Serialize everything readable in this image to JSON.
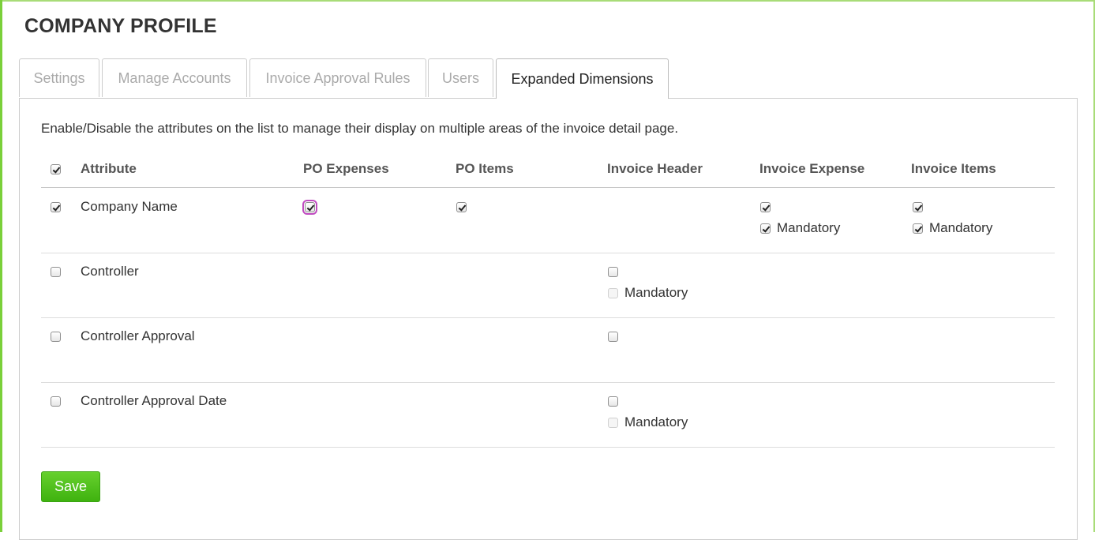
{
  "page": {
    "title": "COMPANY PROFILE"
  },
  "tabs": [
    {
      "label": "Settings"
    },
    {
      "label": "Manage Accounts"
    },
    {
      "label": "Invoice Approval Rules"
    },
    {
      "label": "Users"
    },
    {
      "label": "Expanded Dimensions",
      "active": true
    }
  ],
  "panel": {
    "intro": "Enable/Disable the attributes on the list to manage their display on multiple areas of the invoice detail page."
  },
  "table": {
    "select_all_checked": true,
    "columns": [
      "Attribute",
      "PO Expenses",
      "PO Items",
      "Invoice Header",
      "Invoice Expense",
      "Invoice Items"
    ],
    "mandatory_label": "Mandatory",
    "rows": [
      {
        "attribute": "Company Name",
        "enabled": true,
        "po_expenses": {
          "checked": true,
          "focused": true
        },
        "po_items": {
          "checked": true
        },
        "invoice_expense": {
          "checked": true,
          "mandatory": true
        },
        "invoice_items": {
          "checked": true,
          "mandatory": true
        }
      },
      {
        "attribute": "Controller",
        "enabled": false,
        "invoice_header": {
          "checked": false,
          "mandatory": false,
          "mandatory_disabled": true
        }
      },
      {
        "attribute": "Controller Approval",
        "enabled": false,
        "invoice_header": {
          "checked": false
        }
      },
      {
        "attribute": "Controller Approval Date",
        "enabled": false,
        "invoice_header": {
          "checked": false,
          "mandatory": false,
          "mandatory_disabled": true
        }
      }
    ]
  },
  "actions": {
    "save_label": "Save"
  },
  "colors": {
    "accent": "#7ad03a",
    "save_button": "#4cbf1a",
    "focus_ring": "#c04bc0"
  }
}
